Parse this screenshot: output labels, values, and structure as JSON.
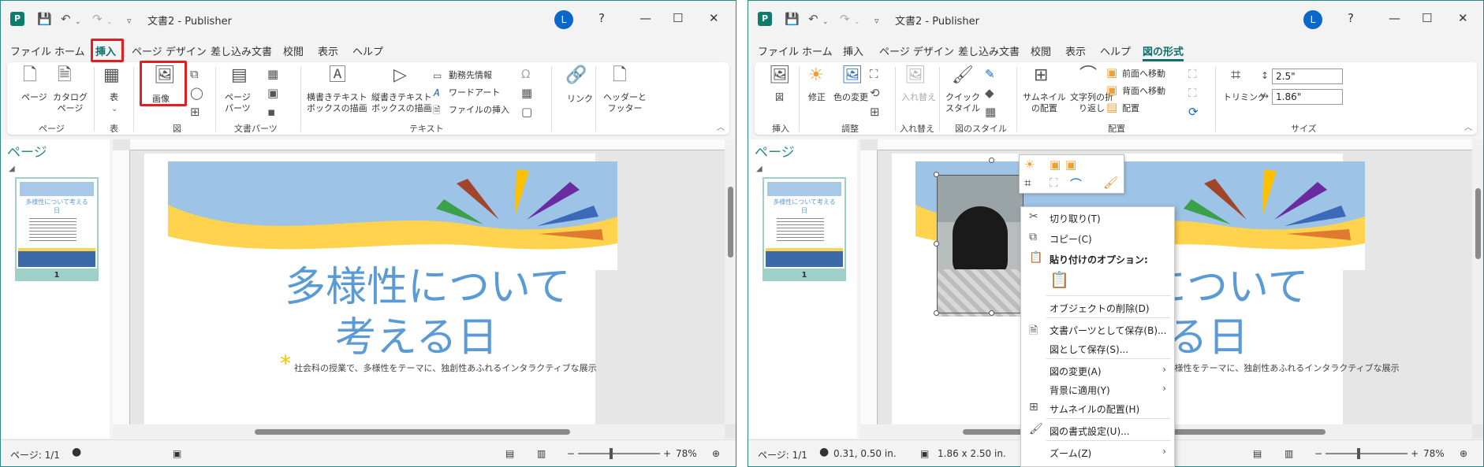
{
  "left": {
    "title": "文書2  -  Publisher",
    "avatar": "L",
    "help": "?",
    "tabs": [
      "ファイル",
      "ホーム",
      "挿入",
      "ページ デザイン",
      "差し込み文書",
      "校閲",
      "表示",
      "ヘルプ"
    ],
    "ribbon": {
      "page": "ページ",
      "catalog": "カタログ\nページ",
      "table": "表",
      "image": "画像",
      "parts": "ページ\nパーツ",
      "textbox_h": "横書きテキスト\nボックスの描画",
      "textbox_v": "縦書きテキスト\nボックスの描画",
      "business": "勤務先情報",
      "wordart": "ワードアート",
      "insert_file": "ファイルの挿入",
      "link": "リンク",
      "header_footer": "ヘッダーと\nフッター",
      "groups": [
        "ページ",
        "表",
        "図",
        "文書パーツ",
        "テキスト"
      ]
    },
    "pages_title": "ページ",
    "thumb_num": "1",
    "thumb_title": "多様性について考える日",
    "doc_title_1": "多様性について",
    "doc_title_2": "考える日",
    "body_text": "社会科の授業で、多様性をテーマに、独創性あふれるインタラクティブな展示",
    "status_page": "ページ: 1/1",
    "zoom": "78%"
  },
  "right": {
    "title": "文書2  -  Publisher",
    "avatar": "L",
    "help": "?",
    "tabs": [
      "ファイル",
      "ホーム",
      "挿入",
      "ページ デザイン",
      "差し込み文書",
      "校閲",
      "表示",
      "ヘルプ",
      "図の形式"
    ],
    "ribbon": {
      "figure": "図",
      "correct": "修正",
      "recolor": "色の変更",
      "swap": "入れ替え",
      "quick_style": "クイック\nスタイル",
      "thumbnail": "サムネイル\nの配置",
      "wrap": "文字列の折\nり返し",
      "front": "前面へ移動",
      "back": "背面へ移動",
      "arrange": "配置",
      "trim": "トリミング",
      "height": "2.5\"",
      "width": "1.86\"",
      "groups": [
        "挿入",
        "調整",
        "入れ替え",
        "図のスタイル",
        "配置",
        "サイズ"
      ]
    },
    "pages_title": "ページ",
    "thumb_num": "1",
    "thumb_title": "多様性について考える日",
    "doc_title_1": "性について",
    "doc_title_2": "考える日",
    "body_text": "社会科の授業で、多様性をテーマに、独創性あふれるインタラクティブな展示",
    "status_page": "ページ: 1/1",
    "status_pos": "0.31, 0.50 in.",
    "status_size": "1.86 x 2.50 in.",
    "zoom": "78%",
    "context_menu": [
      {
        "label": "切り取り(T)",
        "icon": "scissors-icon"
      },
      {
        "label": "コピー(C)",
        "icon": "copy-icon"
      },
      {
        "label": "貼り付けのオプション:",
        "icon": "paste-icon"
      },
      {
        "label": "オブジェクトの削除(D)",
        "icon": ""
      },
      {
        "label": "文書パーツとして保存(B)...",
        "icon": "save-part-icon"
      },
      {
        "label": "図として保存(S)...",
        "icon": ""
      },
      {
        "label": "図の変更(A)",
        "icon": "",
        "submenu": true
      },
      {
        "label": "背景に適用(Y)",
        "icon": "",
        "submenu": true
      },
      {
        "label": "サムネイルの配置(H)",
        "icon": "thumbnail-icon"
      },
      {
        "label": "図の書式設定(U)...",
        "icon": "format-picture-icon"
      },
      {
        "label": "ズーム(Z)",
        "icon": "",
        "submenu": true
      }
    ]
  }
}
